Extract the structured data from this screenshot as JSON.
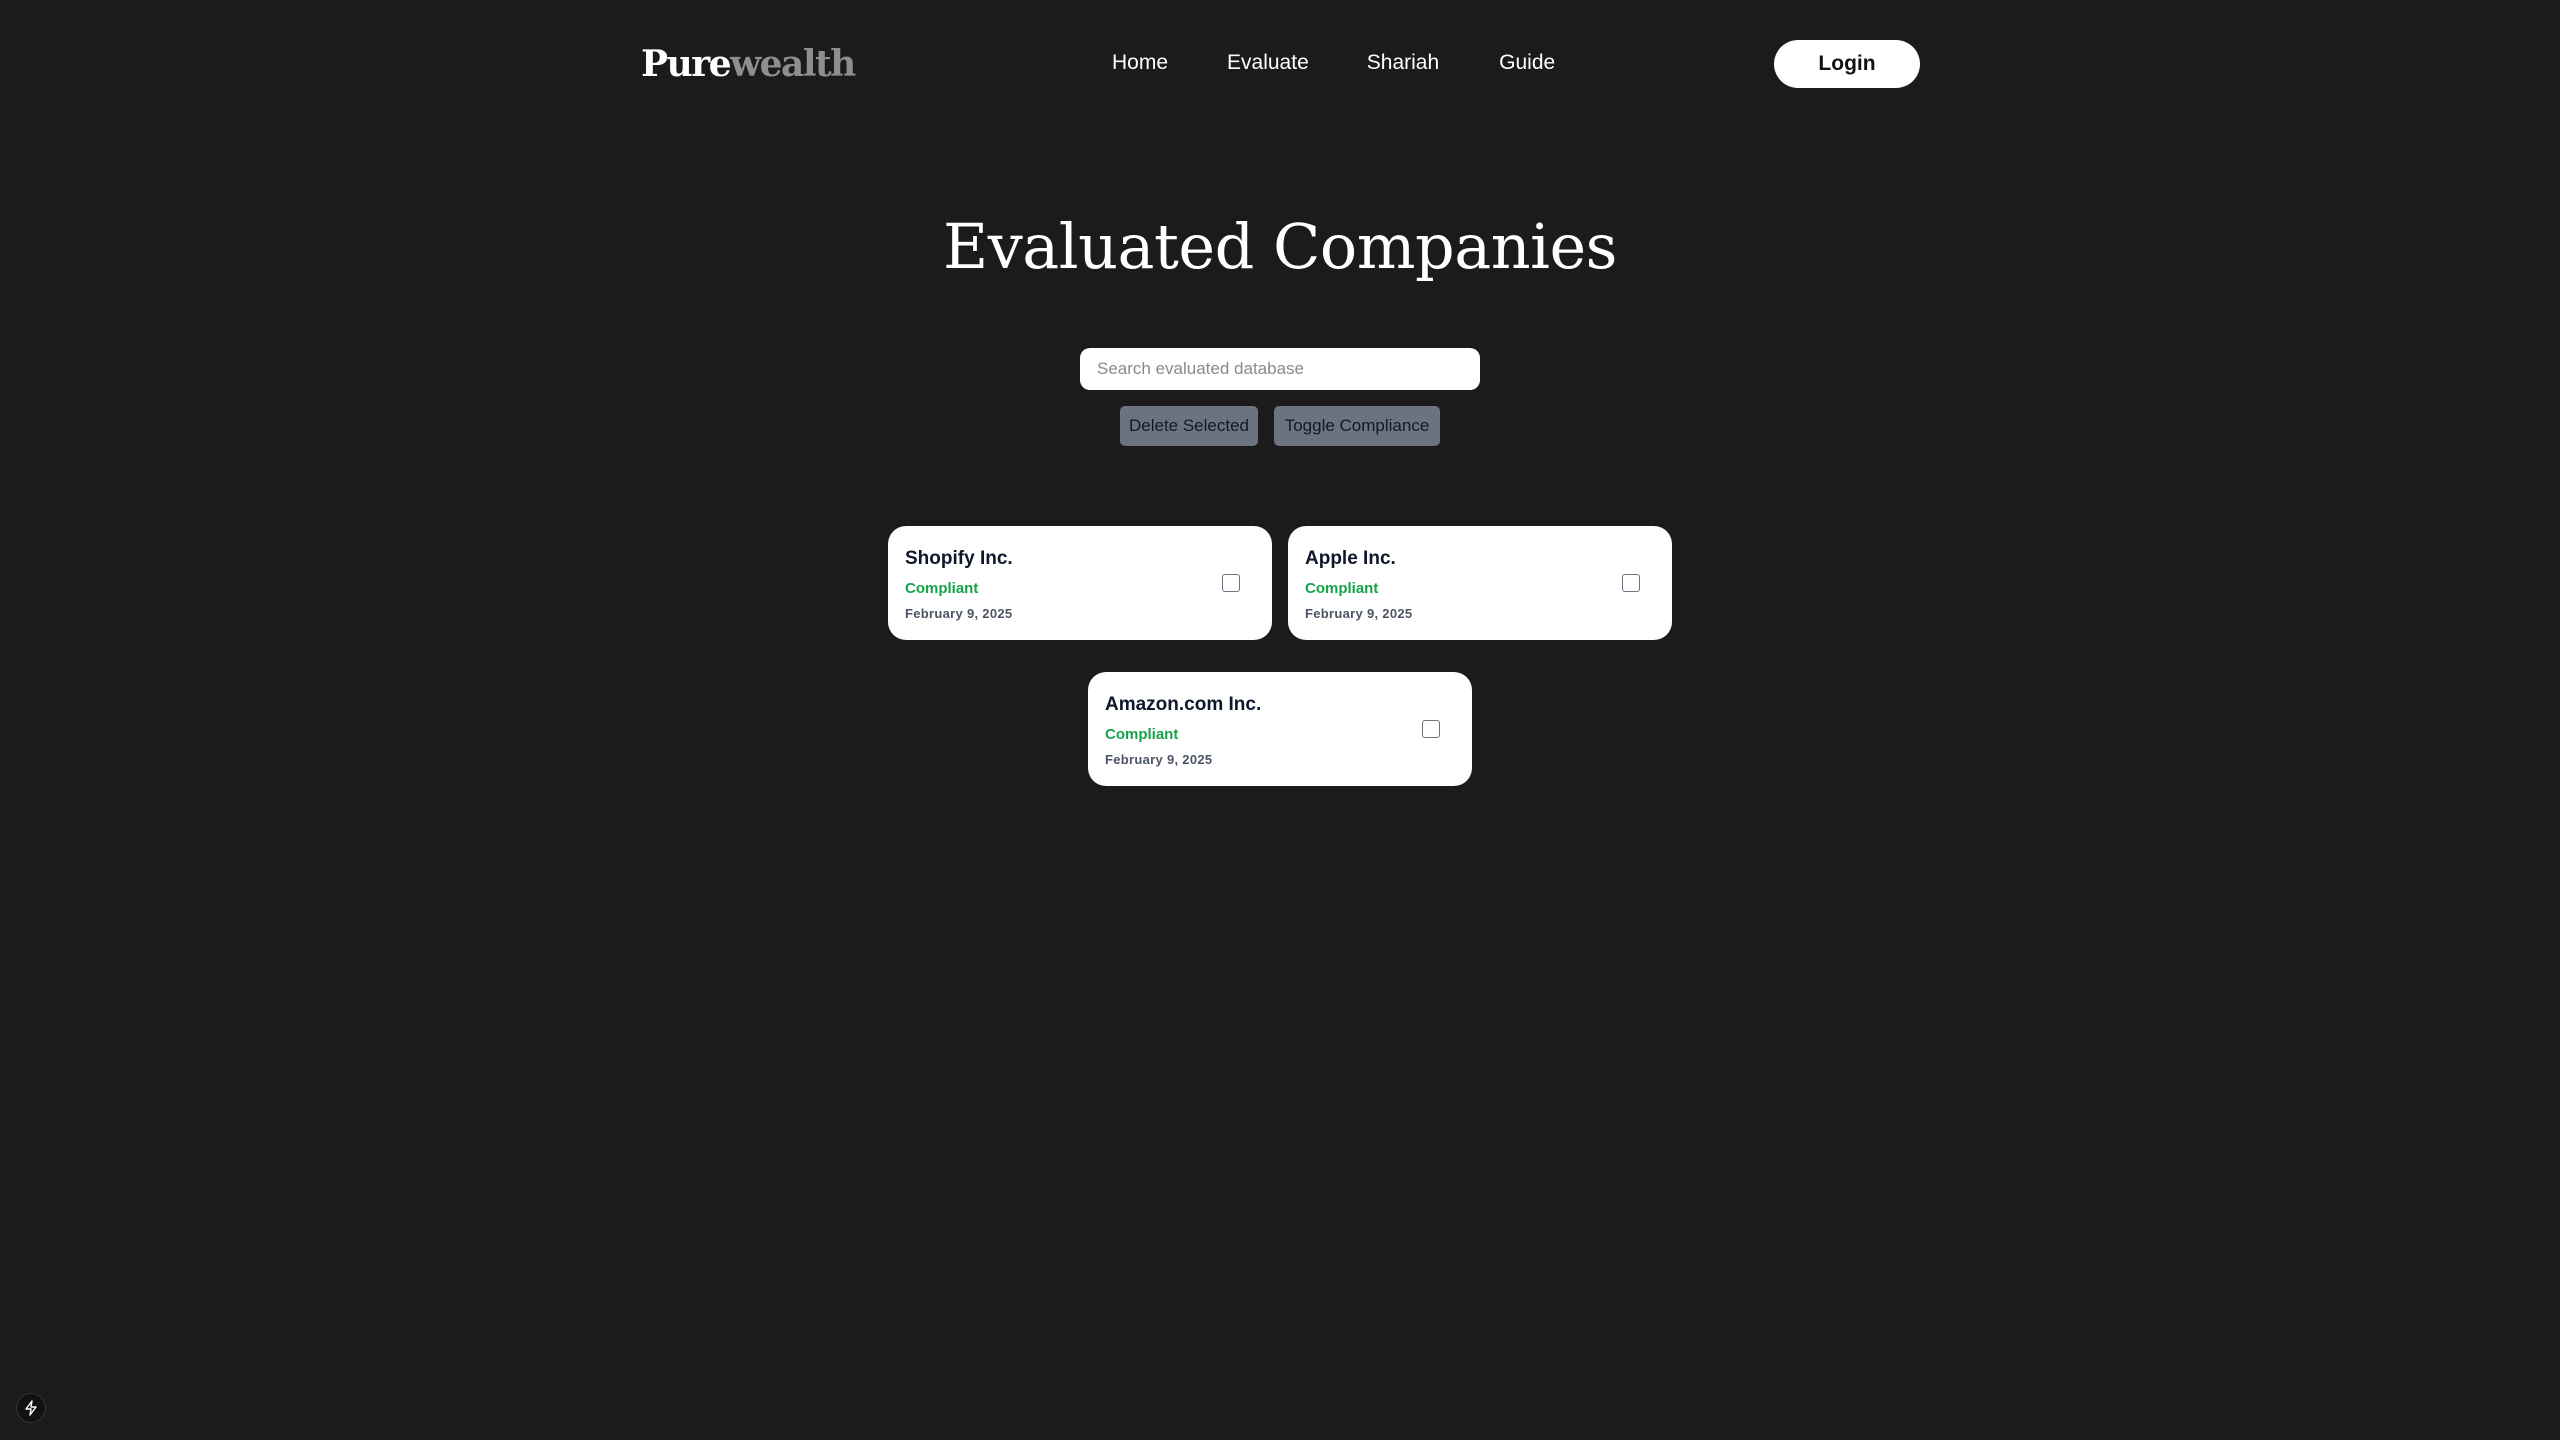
{
  "header": {
    "logo": {
      "part1": "Pure",
      "part2": "wealth"
    },
    "nav": [
      {
        "label": "Home"
      },
      {
        "label": "Evaluate"
      },
      {
        "label": "Shariah"
      },
      {
        "label": "Guide"
      }
    ],
    "login_label": "Login"
  },
  "main": {
    "title": "Evaluated Companies",
    "search": {
      "placeholder": "Search evaluated database",
      "value": ""
    },
    "actions": {
      "delete_label": "Delete Selected",
      "toggle_label": "Toggle Compliance"
    },
    "companies": [
      {
        "name": "Shopify Inc.",
        "status": "Compliant",
        "date": "February 9, 2025",
        "checked": false
      },
      {
        "name": "Apple Inc.",
        "status": "Compliant",
        "date": "February 9, 2025",
        "checked": false
      },
      {
        "name": "Amazon.com Inc.",
        "status": "Compliant",
        "date": "February 9, 2025",
        "checked": false
      }
    ]
  },
  "dev_indicator": {
    "icon": "lightning-bolt-icon"
  },
  "colors": {
    "background": "#1b1b1b",
    "compliant": "#16a34a",
    "action_button": "#6b7280"
  }
}
